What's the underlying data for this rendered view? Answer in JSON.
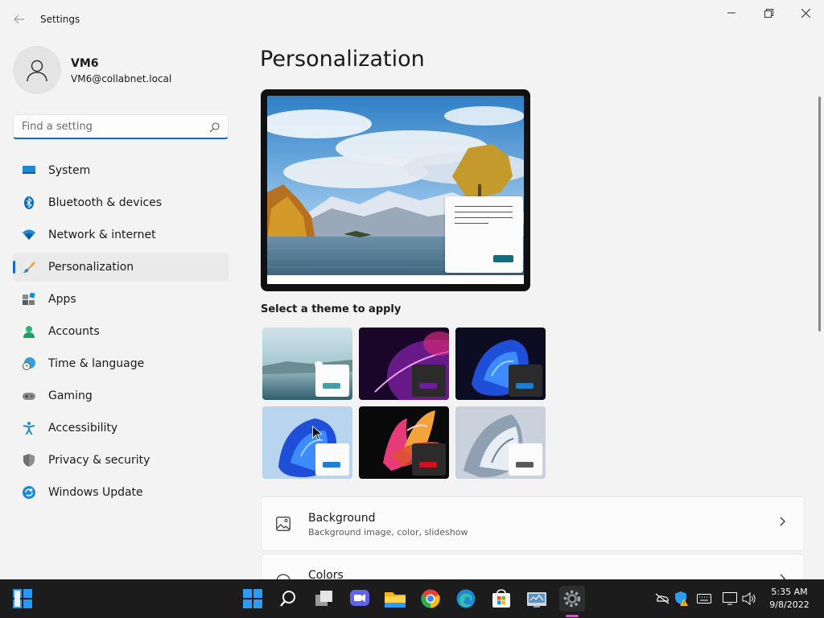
{
  "window": {
    "title": "Settings",
    "back_icon": "back-arrow-icon",
    "controls": [
      "minimize-icon",
      "restore-icon",
      "close-icon"
    ]
  },
  "user": {
    "name": "VM6",
    "email": "VM6@collabnet.local",
    "avatar_icon": "person-icon"
  },
  "search": {
    "placeholder": "Find a setting",
    "value": ""
  },
  "sidebar": {
    "selected": "Personalization",
    "items": [
      {
        "label": "System",
        "icon": "monitor-icon"
      },
      {
        "label": "Bluetooth & devices",
        "icon": "bluetooth-icon"
      },
      {
        "label": "Network & internet",
        "icon": "wifi-icon"
      },
      {
        "label": "Personalization",
        "icon": "brush-icon"
      },
      {
        "label": "Apps",
        "icon": "apps-icon"
      },
      {
        "label": "Accounts",
        "icon": "account-icon"
      },
      {
        "label": "Time & language",
        "icon": "clock-globe-icon"
      },
      {
        "label": "Gaming",
        "icon": "gamepad-icon"
      },
      {
        "label": "Accessibility",
        "icon": "accessibility-icon"
      },
      {
        "label": "Privacy & security",
        "icon": "shield-icon"
      },
      {
        "label": "Windows Update",
        "icon": "update-icon"
      }
    ]
  },
  "main": {
    "title": "Personalization",
    "theme_label": "Select a theme to apply",
    "themes": [
      {
        "name": "theme-lake",
        "accent": "#4a9aa8"
      },
      {
        "name": "theme-glow",
        "accent": "#6b1f9a"
      },
      {
        "name": "theme-bloom-dark",
        "accent": "#1e7fd1"
      },
      {
        "name": "theme-bloom-light",
        "accent": "#1e7fd1"
      },
      {
        "name": "theme-captured-motion",
        "accent": "#d0101a"
      },
      {
        "name": "theme-flow",
        "accent": "#5a5a5a"
      }
    ],
    "cards": [
      {
        "title": "Background",
        "subtitle": "Background image, color, slideshow",
        "icon": "image-icon"
      },
      {
        "title": "Colors",
        "subtitle": "",
        "icon": "palette-icon"
      }
    ]
  },
  "taskbar": {
    "apps": [
      "start-icon",
      "search-icon",
      "task-view-icon",
      "chat-icon",
      "file-explorer-icon",
      "chrome-icon",
      "edge-icon",
      "store-icon",
      "control-panel-icon",
      "settings-icon"
    ],
    "tray": [
      "network-off-icon",
      "security-warning-icon",
      "keyboard-icon",
      "display-icon",
      "volume-icon"
    ],
    "time": "5:35 AM",
    "date": "9/8/2022"
  },
  "colors": {
    "accent": "#0f6cbd",
    "background": "#f3f3f3",
    "taskbar": "#1c1c1c"
  }
}
